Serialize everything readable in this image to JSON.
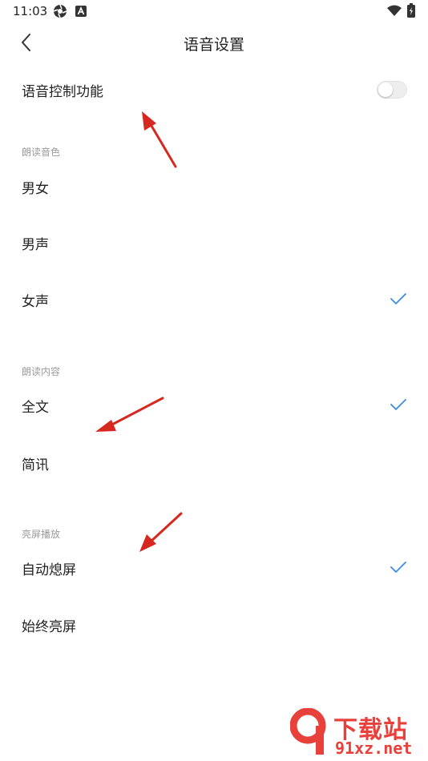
{
  "status_bar": {
    "time": "11:03"
  },
  "header": {
    "title": "语音设置"
  },
  "voice_control": {
    "label": "语音控制功能",
    "enabled": false
  },
  "sections": {
    "voice": {
      "title": "朗读音色",
      "options": [
        {
          "label": "男女",
          "selected": false
        },
        {
          "label": "男声",
          "selected": false
        },
        {
          "label": "女声",
          "selected": true
        }
      ]
    },
    "content": {
      "title": "朗读内容",
      "options": [
        {
          "label": "全文",
          "selected": true
        },
        {
          "label": "简讯",
          "selected": false
        }
      ]
    },
    "screen": {
      "title": "亮屏播放",
      "options": [
        {
          "label": "自动熄屏",
          "selected": true
        },
        {
          "label": "始终亮屏",
          "selected": false
        }
      ]
    }
  },
  "watermark": {
    "brand": "下载站",
    "url": "91xz.net"
  },
  "colors": {
    "check": "#3c8ce7",
    "annotation": "#d7281f",
    "section_text": "#9a9a9a"
  }
}
